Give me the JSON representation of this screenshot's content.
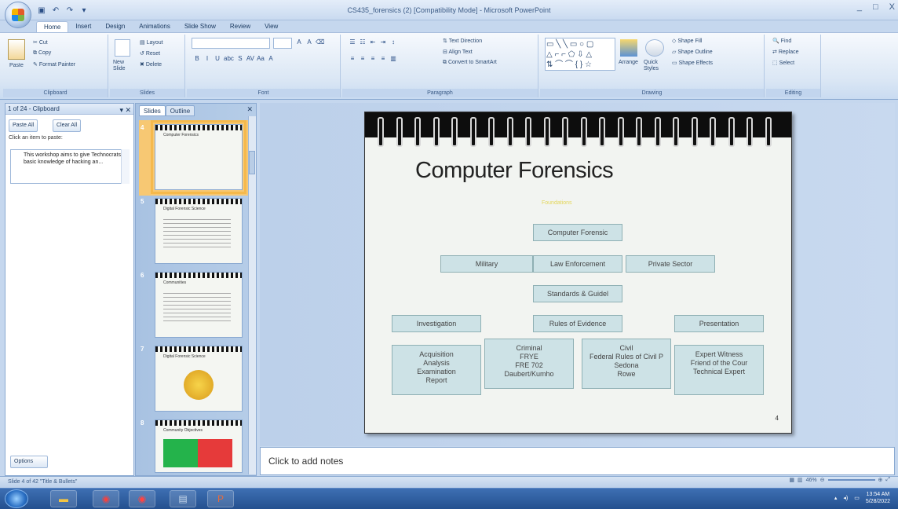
{
  "window": {
    "title": "CS435_forensics (2) [Compatibility Mode] - Microsoft PowerPoint",
    "controls": [
      "_",
      "□",
      "X"
    ]
  },
  "tabs": [
    "Home",
    "Insert",
    "Design",
    "Animations",
    "Slide Show",
    "Review",
    "View"
  ],
  "ribbon": {
    "clipboard": {
      "paste": "Paste",
      "cut": "Cut",
      "copy": "Copy",
      "format_painter": "Format Painter",
      "label": "Clipboard"
    },
    "slides": {
      "new_slide": "New Slide",
      "layout": "Layout",
      "reset": "Reset",
      "delete": "Delete",
      "label": "Slides"
    },
    "font": {
      "label": "Font"
    },
    "paragraph": {
      "text_direction": "Text Direction",
      "align_text": "Align Text",
      "convert_smartart": "Convert to SmartArt",
      "label": "Paragraph"
    },
    "drawing": {
      "arrange": "Arrange",
      "quick_styles": "Quick Styles",
      "shape_fill": "Shape Fill",
      "shape_outline": "Shape Outline",
      "shape_effects": "Shape Effects",
      "label": "Drawing"
    },
    "editing": {
      "find": "Find",
      "replace": "Replace",
      "select": "Select",
      "label": "Editing"
    }
  },
  "clipboard_pane": {
    "header": "1 of 24 - Clipboard",
    "paste_all": "Paste All",
    "clear_all": "Clear All",
    "hint": "Click an item to paste:",
    "item": "This workshop aims to give Technocrats a basic knowledge of hacking an...",
    "options": "Options"
  },
  "slides_pane": {
    "tab_slides": "Slides",
    "tab_outline": "Outline",
    "thumbs": [
      {
        "num": "4",
        "title": "Computer Forensics"
      },
      {
        "num": "5",
        "title": "Digital Forensic Science"
      },
      {
        "num": "6",
        "title": "Communities"
      },
      {
        "num": "7",
        "title": "Digital Forensic Science"
      },
      {
        "num": "8",
        "title": "Community Objectives"
      }
    ]
  },
  "slide": {
    "title": "Computer Forensics",
    "subtitle": "Foundations",
    "page": "4",
    "boxes": {
      "top": "Computer Forensic",
      "military": "Military",
      "law": "Law Enforcement",
      "private": "Private Sector",
      "standards": "Standards & Guidel",
      "investigation": "Investigation",
      "rules": "Rules of Evidence",
      "presentation": "Presentation",
      "acq": [
        "Acquisition",
        "Analysis",
        "Examination",
        "Report"
      ],
      "criminal": [
        "Criminal",
        "FRYE",
        "FRE 702",
        "Daubert/Kumho"
      ],
      "civil": [
        "Civil",
        "Federal Rules of Civil P",
        "Sedona",
        "Rowe"
      ],
      "expert": [
        "Expert Witness",
        "Friend of the Cour",
        "Technical Expert"
      ]
    }
  },
  "notes": "Click to add notes",
  "status": {
    "text": "Slide 4 of 42   \"Title & Bullets\"",
    "zoom": "46%"
  },
  "tray": {
    "time": "13:54 AM",
    "date": "5/28/2022"
  }
}
